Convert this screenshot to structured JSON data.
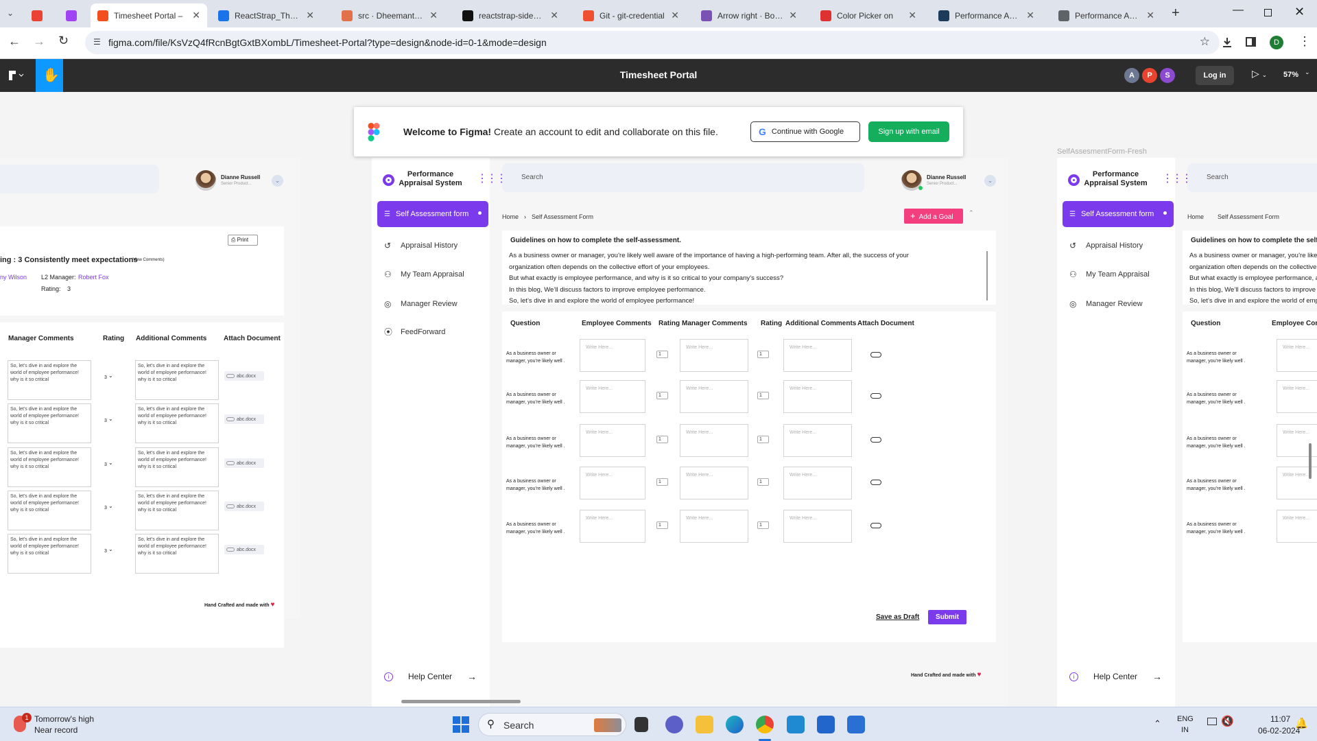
{
  "browser": {
    "tabs": [
      {
        "label": "",
        "color": "#5f6368"
      },
      {
        "label": "",
        "color": "#ea4335"
      },
      {
        "label": "",
        "color": "#a142f4"
      },
      {
        "label": "Timesheet Portal – ",
        "color": "#f24e1e"
      },
      {
        "label": "ReactStrap_Theme",
        "color": "#1a73e8"
      },
      {
        "label": "src · Dheemanth_Te",
        "color": "#e2714b"
      },
      {
        "label": "reactstrap-sidebar",
        "color": "#111111"
      },
      {
        "label": "Git - git-credential",
        "color": "#f05032"
      },
      {
        "label": "Arrow right · Boots",
        "color": "#7952b3"
      },
      {
        "label": "Color Picker on",
        "color": "#e03131"
      },
      {
        "label": "Performance Appra",
        "color": "#1c3b5a"
      },
      {
        "label": "Performance Appra",
        "color": "#5f6368"
      }
    ],
    "url": "figma.com/file/KsVzQ4fRcnBgtGxtBXombL/Timesheet-Portal?type=design&node-id=0-1&mode=design",
    "profile_initial": "D"
  },
  "figma": {
    "file_title": "Timesheet Portal",
    "avatars": [
      {
        "initial": "A",
        "color": "#6d7892"
      },
      {
        "initial": "P",
        "color": "#e8442f"
      },
      {
        "initial": "S",
        "color": "#8c4ad1"
      }
    ],
    "login_label": "Log in",
    "zoom": "57%",
    "banner": {
      "bold": "Welcome to Figma!",
      "text": " Create an account to edit and collaborate on this file.",
      "google": "Continue with Google",
      "signup": "Sign up with email"
    },
    "frame_label": "SelfAssesmentForm-Fresh"
  },
  "app": {
    "brand": "Performance Appraisal System",
    "search_placeholder": "Search",
    "user_name": "Dianne Russell",
    "user_role": "Senior Product...",
    "nav": [
      "Self Assessment form",
      "Appraisal History",
      "My Team Appraisal",
      "Manager Review",
      "FeedForward"
    ],
    "help": "Help Center",
    "footer": "Hand Crafted and made with",
    "breadcrumb": {
      "home": "Home",
      "current": "Self Assessment Form"
    },
    "add_goal": "Add a Goal",
    "guidelines_title": "Guidelines on how to complete the self-assessment.",
    "guidelines": [
      "As a business owner or manager, you’re likely well aware of the importance of having a high-performing team. After all, the success of your",
      "organization often depends on the collective effort of your employees.",
      "But what exactly is employee performance, and why is it so critical to your company’s success?",
      "In this blog, We’ll discuss factors to improve employee performance.",
      "So, let’s dive in and explore the world of employee performance!"
    ],
    "headers": [
      "Question",
      "Employee Comments",
      "Rating",
      "Manager Comments",
      "Rating",
      "Additional Comments",
      "Attach Document"
    ],
    "question": "As a business owner or manager, you’re likely well .",
    "placeholder": "Write Here...",
    "rating_value": "1",
    "save_draft": "Save as Draft",
    "submit": "Submit"
  },
  "left_frame": {
    "print": "Print",
    "rating_line": "ing : 3 Consistently meet expectations",
    "view_comments": "(View Comments)",
    "name_frag": "ny Wilson",
    "l2_label": "L2 Manager:",
    "l2_value": "Robert Fox",
    "rating_label": "Rating:",
    "rating_value": "3",
    "headers": [
      "Manager Comments",
      "Rating",
      "Additional Comments",
      "Attach Document"
    ],
    "comment": "So, let’s dive in and explore the world of employee performance! why is it so critical",
    "row_rating": "3",
    "file": "abc.docx"
  },
  "taskbar": {
    "weather_line1": "Tomorrow's high",
    "weather_line2": "Near record",
    "badge": "1",
    "search": "Search",
    "lang1": "ENG",
    "lang2": "IN",
    "time": "11:07",
    "date": "06-02-2024"
  }
}
